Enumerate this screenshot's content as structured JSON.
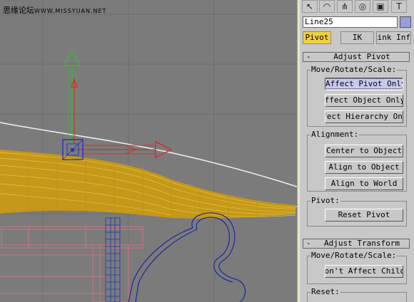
{
  "watermark": {
    "brand": "思缘论坛",
    "url": "WWW.MISSYUAN.NET"
  },
  "toolbar": [
    {
      "name": "create-tab-icon",
      "glyph": "↖"
    },
    {
      "name": "modify-tab-icon",
      "glyph": "◠"
    },
    {
      "name": "hierarchy-tab-icon",
      "glyph": "⋔"
    },
    {
      "name": "motion-tab-icon",
      "glyph": "◎"
    },
    {
      "name": "display-tab-icon",
      "glyph": "▣"
    },
    {
      "name": "utilities-tab-icon",
      "glyph": "T"
    }
  ],
  "object": {
    "name": "Line25",
    "color": "#9b9be0"
  },
  "tabs": [
    {
      "label": "Pivot",
      "active": true
    },
    {
      "label": "IK",
      "active": false
    },
    {
      "label": "Link Inf",
      "active": false
    }
  ],
  "adjust_pivot": {
    "title": "Adjust Pivot",
    "move_rotate_scale_label": "Move/Rotate/Scale:",
    "affect_pivot_only": "Affect Pivot Only",
    "affect_object_only": "Affect Object Only",
    "affect_hierarchy_only": "Affect Hierarchy Only",
    "alignment_label": "Alignment:",
    "center_to_object": "Center to Object",
    "align_to_object": "Align to Object",
    "align_to_world": "Align to World",
    "pivot_label": "Pivot:",
    "reset_pivot": "Reset Pivot"
  },
  "adjust_transform": {
    "title": "Adjust Transform",
    "move_rotate_scale_label": "Move/Rotate/Scale:",
    "dont_affect_children": "Don't Affect Children",
    "reset_label": "Reset:"
  },
  "colors": {
    "roof": "#d4a81a",
    "gizmo_red": "#e02020",
    "gizmo_green": "#30c030",
    "gizmo_blue": "#2020c0",
    "pink": "#c06070",
    "blue_obj": "#1830a0",
    "accent_tab": "#f0d040"
  }
}
